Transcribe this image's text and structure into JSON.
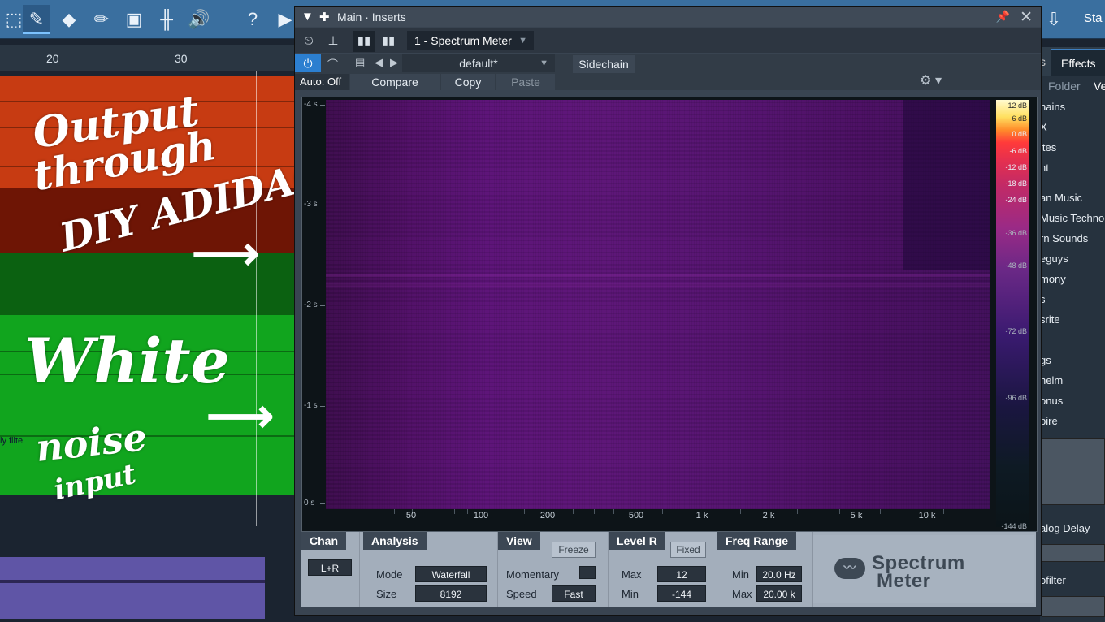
{
  "toolbar": {
    "help": "?",
    "stat_label": "Sta"
  },
  "ruler": {
    "ticks": [
      "20",
      "30"
    ]
  },
  "tracks": {
    "filter_hint": "ly filte"
  },
  "annotations": {
    "line1": "Output",
    "line2": "through",
    "line3": "DIY ADIDAC",
    "line4": "White",
    "line5": "noise",
    "line6": "input"
  },
  "browser": {
    "tab_partial": "s",
    "tab_effects": "Effects",
    "folder": "Folder",
    "sub_right": "Ve",
    "items": [
      "hains",
      "X",
      "ites",
      "nt",
      "an Music",
      "Music Techno",
      "rn Sounds",
      "eguys",
      "mony",
      "s",
      "srite",
      "gs",
      "helm",
      "onus",
      "pire",
      "alog Delay",
      "ofilter"
    ]
  },
  "plugin": {
    "title": "Main · Inserts",
    "insert_name": "1 - Spectrum Meter",
    "preset": "default*",
    "sidechain": "Sidechain",
    "auto": "Auto: Off",
    "compare": "Compare",
    "copy": "Copy",
    "paste": "Paste"
  },
  "display": {
    "y_ticks": [
      "-4 s",
      "-3 s",
      "-2 s",
      "-1 s",
      "0 s"
    ],
    "x_ticks": [
      "50",
      "100",
      "200",
      "500",
      "1 k",
      "2 k",
      "5 k",
      "10 k"
    ],
    "db_ticks": [
      "12 dB",
      "6 dB",
      "0 dB",
      "-6 dB",
      "-12 dB",
      "-18 dB",
      "-24 dB",
      "-36 dB",
      "-48 dB",
      "-72 dB",
      "-96 dB",
      "-144 dB"
    ]
  },
  "controls": {
    "chan": {
      "title": "Chan",
      "value": "L+R"
    },
    "analysis": {
      "title": "Analysis",
      "mode_label": "Mode",
      "mode_value": "Waterfall",
      "size_label": "Size",
      "size_value": "8192"
    },
    "view": {
      "title": "View",
      "freeze": "Freeze",
      "momentary_label": "Momentary",
      "speed_label": "Speed",
      "speed_value": "Fast"
    },
    "level": {
      "title": "Level R",
      "fixed": "Fixed",
      "max_label": "Max",
      "max_value": "12",
      "min_label": "Min",
      "min_value": "-144"
    },
    "freq": {
      "title": "Freq Range",
      "min_label": "Min",
      "min_value": "20.0 Hz",
      "max_label": "Max",
      "max_value": "20.00 k"
    }
  },
  "logo": {
    "line1": "Spectrum",
    "line2": "Meter"
  }
}
